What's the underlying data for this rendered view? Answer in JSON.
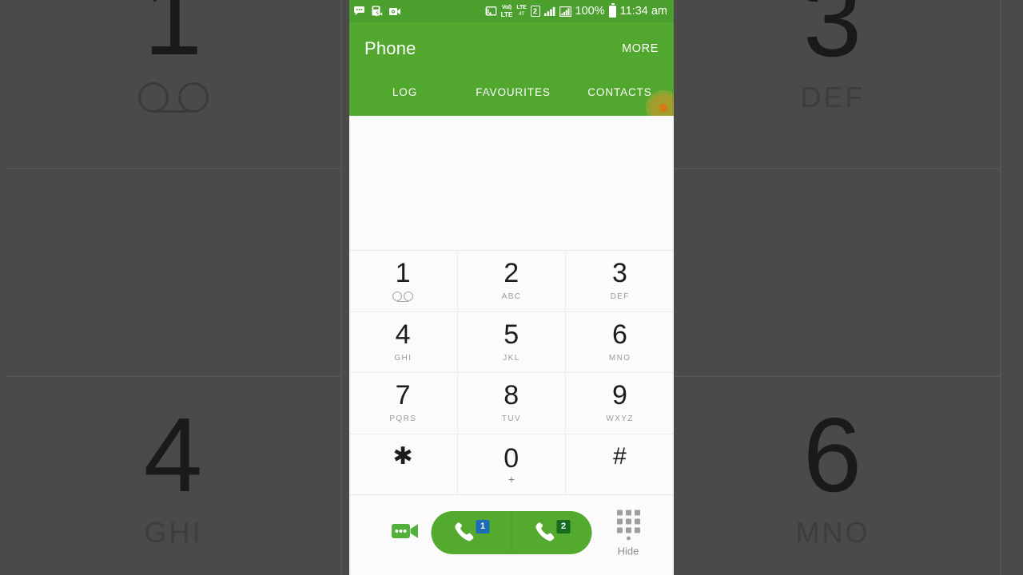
{
  "status_bar": {
    "icons": [
      {
        "name": "messages-icon",
        "label": "messages"
      },
      {
        "name": "screenshot-capture-icon",
        "label": "smart-capture"
      },
      {
        "name": "video-recorder-icon",
        "label": "video-recorder"
      },
      {
        "name": "screen-cast-icon",
        "label": "smart-view"
      },
      {
        "name": "volte-icon",
        "label_top": "VoLTE",
        "label_bottom": "LTE"
      },
      {
        "name": "lte-icon",
        "label_top": "LTE",
        "label_bottom": "4T"
      },
      {
        "name": "sim2-icon",
        "label": "2"
      },
      {
        "name": "signal-bars-1-icon",
        "label": "signal-sim1"
      },
      {
        "name": "signal-bars-2-icon",
        "label": "signal-sim2"
      }
    ],
    "volte_top": "VoI)",
    "volte_bottom": "LTE",
    "lte_top": "LTE",
    "lte_bottom": "4T",
    "sim_indicator": "2",
    "battery_percent": "100%",
    "time": "11:34 am"
  },
  "app_bar": {
    "title": "Phone",
    "more_label": "MORE",
    "tabs": [
      {
        "label": "LOG",
        "active": false
      },
      {
        "label": "FAVOURITES",
        "active": false
      },
      {
        "label": "CONTACTS",
        "active": false
      }
    ]
  },
  "number_display": {
    "value": "",
    "placeholder": ""
  },
  "dialpad": {
    "rows": [
      [
        {
          "digit": "1",
          "sub": "",
          "icon": "voicemail-icon"
        },
        {
          "digit": "2",
          "sub": "ABC",
          "icon": ""
        },
        {
          "digit": "3",
          "sub": "DEF",
          "icon": ""
        }
      ],
      [
        {
          "digit": "4",
          "sub": "GHI",
          "icon": ""
        },
        {
          "digit": "5",
          "sub": "JKL",
          "icon": ""
        },
        {
          "digit": "6",
          "sub": "MNO",
          "icon": ""
        }
      ],
      [
        {
          "digit": "7",
          "sub": "PQRS",
          "icon": ""
        },
        {
          "digit": "8",
          "sub": "TUV",
          "icon": ""
        },
        {
          "digit": "9",
          "sub": "WXYZ",
          "icon": ""
        }
      ],
      [
        {
          "digit": "✱",
          "sub": "",
          "icon": ""
        },
        {
          "digit": "0",
          "sub": "+",
          "icon": ""
        },
        {
          "digit": "#",
          "sub": "",
          "icon": ""
        }
      ]
    ]
  },
  "action_bar": {
    "video_call_icon": "video-call-icon",
    "call_sim1_badge": "1",
    "call_sim2_badge": "2",
    "hide_label": "Hide",
    "keypad_icon": "keypad-icon"
  },
  "background": {
    "left_cells": [
      {
        "digit": "1",
        "sub": "",
        "icon": "voicemail-icon"
      },
      {
        "digit": "4",
        "sub": "GHI",
        "icon": ""
      }
    ],
    "right_cells": [
      {
        "digit": "3",
        "sub": "DEF",
        "icon": ""
      },
      {
        "digit": "6",
        "sub": "MNO",
        "icon": ""
      }
    ]
  },
  "colors": {
    "status_bar_green": "#4b9f2c",
    "app_bar_green": "#52a82f",
    "call_button_green": "#53aa2e",
    "sim1_badge_blue": "#1e6bb8",
    "sim2_badge_green": "#176b1f",
    "touch_indicator_orange": "#de7812",
    "background_grey": "#4a4a4a"
  }
}
